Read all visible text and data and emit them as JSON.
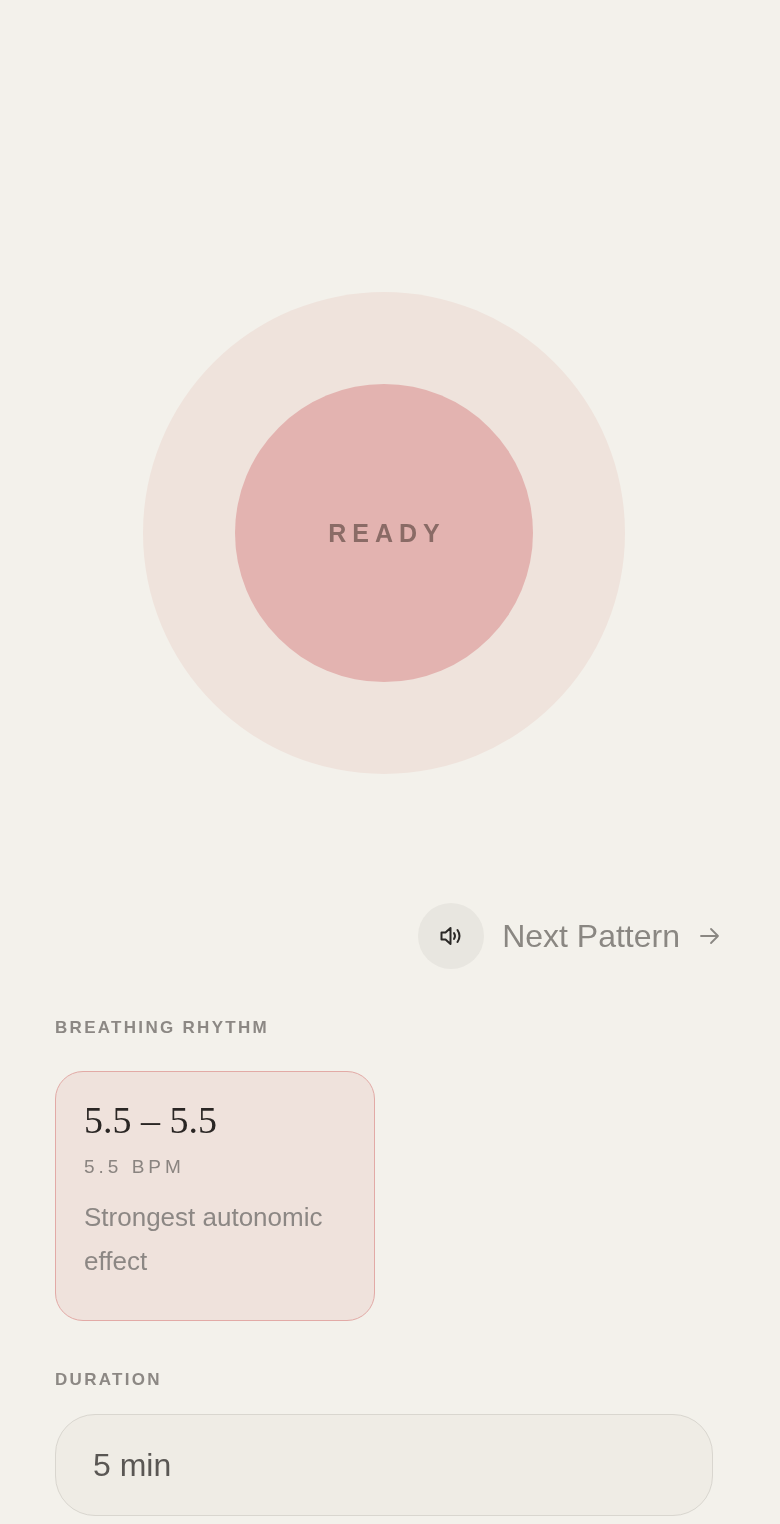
{
  "orb": {
    "label": "READY"
  },
  "controls": {
    "sound": {
      "on": true
    },
    "next_pattern": {
      "label": "Next Pattern"
    }
  },
  "rhythm": {
    "label": "BREATHING RHYTHM",
    "options": [
      {
        "ratio": "5.5 – 5.5",
        "rate": "5.5 BPM",
        "description": "Strongest autonomic effect",
        "selected": true
      }
    ]
  },
  "duration": {
    "label": "DURATION",
    "value": "5 min"
  }
}
